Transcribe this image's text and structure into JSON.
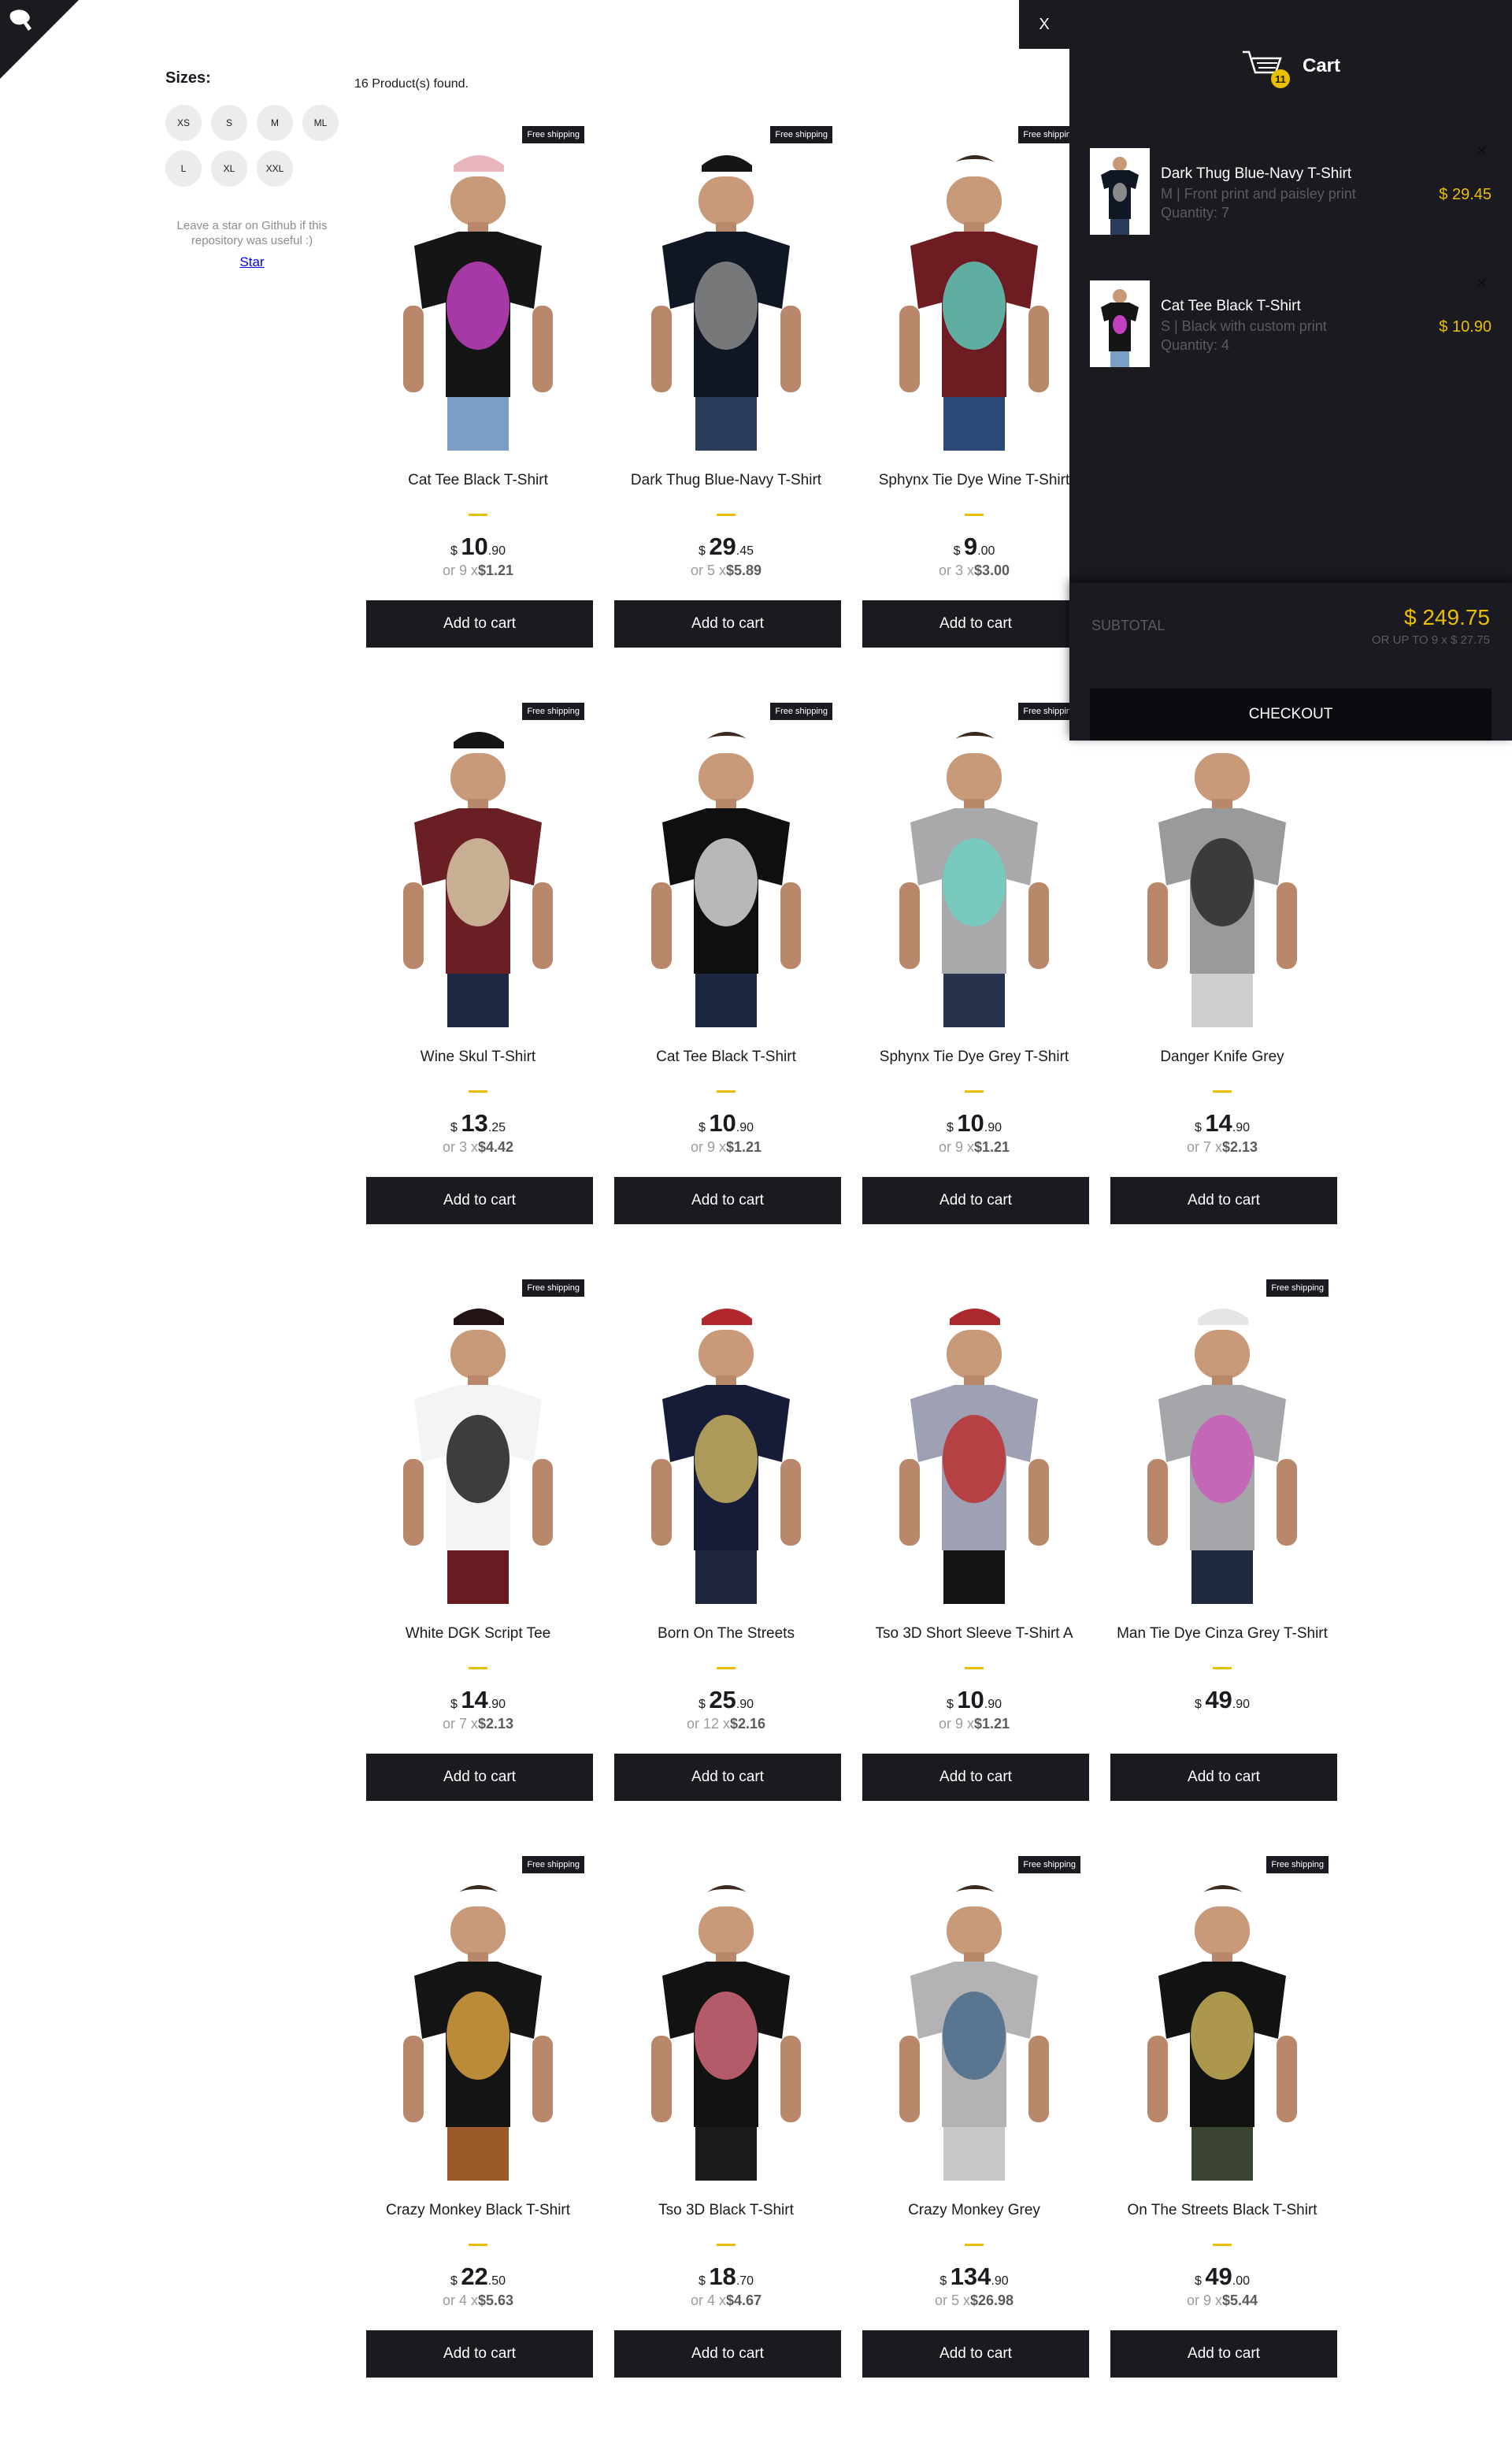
{
  "sidebar": {
    "sizes_title": "Sizes:",
    "sizes": [
      "XS",
      "S",
      "M",
      "ML",
      "L",
      "XL",
      "XXL"
    ],
    "star_note": "Leave a star on Github if this repository was useful :)",
    "star_link": "Star"
  },
  "products_found": "16 Product(s) found.",
  "add_to_cart_label": "Add to cart",
  "free_shipping_label": "Free shipping",
  "products": [
    {
      "title": "Cat Tee Black T-Shirt",
      "currency": "$",
      "int": "10",
      "dec": ".90",
      "inst_prefix": "or 9 x",
      "inst_value": "$1.21",
      "free": true,
      "shirt": "#151515",
      "print": "#c040c0",
      "cap": "#e8b4bd",
      "pants": "#7b9ec4"
    },
    {
      "title": "Dark Thug Blue-Navy T-Shirt",
      "currency": "$",
      "int": "29",
      "dec": ".45",
      "inst_prefix": "or 5 x",
      "inst_value": "$5.89",
      "free": true,
      "shirt": "#111624",
      "print": "#8a8a8a",
      "cap": "#151515",
      "pants": "#2b3c5a"
    },
    {
      "title": "Sphynx Tie Dye Wine T-Shirt",
      "currency": "$",
      "int": "9",
      "dec": ".00",
      "inst_prefix": "or 3 x",
      "inst_value": "$3.00",
      "free": true,
      "shirt": "#6e1c22",
      "print": "#5ec8b8",
      "cap": null,
      "pants": "#2c4a78"
    },
    {
      "title": "Wine Skul T-Shirt",
      "currency": "$",
      "int": "13",
      "dec": ".25",
      "inst_prefix": "or 3 x",
      "inst_value": "$4.42",
      "free": true,
      "shirt": "#6a1f24",
      "print": "#d8c9a8",
      "cap": "#151515",
      "pants": "#1e2a44"
    },
    {
      "title": "Cat Tee Black T-Shirt",
      "currency": "$",
      "int": "10",
      "dec": ".90",
      "inst_prefix": "or 9 x",
      "inst_value": "$1.21",
      "free": true,
      "shirt": "#0f0f0f",
      "print": "#d6d6d6",
      "cap": null,
      "pants": "#1c2740"
    },
    {
      "title": "Sphynx Tie Dye Grey T-Shirt",
      "currency": "$",
      "int": "10",
      "dec": ".90",
      "inst_prefix": "or 9 x",
      "inst_value": "$1.21",
      "free": true,
      "shirt": "#a9a9ab",
      "print": "#6ed0c0",
      "cap": null,
      "pants": "#27324c"
    },
    {
      "title": "Danger Knife Grey",
      "currency": "$",
      "int": "14",
      "dec": ".90",
      "inst_prefix": "or 7 x",
      "inst_value": "$2.13",
      "free": false,
      "shirt": "#9a9a9c",
      "print": "#2a2a2a",
      "cap": null,
      "pants": "#cfcfcf"
    },
    {
      "title": "White DGK Script Tee",
      "currency": "$",
      "int": "14",
      "dec": ".90",
      "inst_prefix": "or 7 x",
      "inst_value": "$2.13",
      "free": true,
      "shirt": "#f4f4f4",
      "print": "#1c1c1c",
      "cap": "#241414",
      "pants": "#6a1a22"
    },
    {
      "title": "Born On The Streets",
      "currency": "$",
      "int": "25",
      "dec": ".90",
      "inst_prefix": "or 12 x",
      "inst_value": "$2.16",
      "free": false,
      "shirt": "#161c38",
      "print": "#c8b060",
      "cap": "#b0282c",
      "pants": "#20263c"
    },
    {
      "title": "Tso 3D Short Sleeve T-Shirt A",
      "currency": "$",
      "int": "10",
      "dec": ".90",
      "inst_prefix": "or 9 x",
      "inst_value": "$1.21",
      "free": false,
      "shirt": "#9ea0b4",
      "print": "#b83030",
      "cap": "#a82a2c",
      "pants": "#141414"
    },
    {
      "title": "Man Tie Dye Cinza Grey T-Shirt",
      "currency": "$",
      "int": "49",
      "dec": ".90",
      "inst_prefix": "",
      "inst_value": "",
      "free": true,
      "shirt": "#a5a6aa",
      "print": "#c85cb8",
      "cap": "#e4e4e4",
      "pants": "#20283c"
    },
    {
      "title": "Crazy Monkey Black T-Shirt",
      "currency": "$",
      "int": "22",
      "dec": ".50",
      "inst_prefix": "or 4 x",
      "inst_value": "$5.63",
      "free": true,
      "shirt": "#141414",
      "print": "#d8a040",
      "cap": null,
      "pants": "#9a5a2a"
    },
    {
      "title": "Tso 3D Black T-Shirt",
      "currency": "$",
      "int": "18",
      "dec": ".70",
      "inst_prefix": "or 4 x",
      "inst_value": "$4.67",
      "free": false,
      "shirt": "#121212",
      "print": "#d06878",
      "cap": null,
      "pants": "#1a1a1a"
    },
    {
      "title": "Crazy Monkey Grey",
      "currency": "$",
      "int": "134",
      "dec": ".90",
      "inst_prefix": "or 5 x",
      "inst_value": "$26.98",
      "free": true,
      "shirt": "#b3b3b5",
      "print": "#4a6a8a",
      "cap": null,
      "pants": "#c7c7c7"
    },
    {
      "title": "On The Streets Black T-Shirt",
      "currency": "$",
      "int": "49",
      "dec": ".00",
      "inst_prefix": "or 9 x",
      "inst_value": "$5.44",
      "free": true,
      "shirt": "#121212",
      "print": "#c8b058",
      "cap": null,
      "pants": "#3a4430"
    }
  ],
  "cart": {
    "close_label": "X",
    "title": "Cart",
    "quantity": "11",
    "items": [
      {
        "title": "Dark Thug Blue-Navy T-Shirt",
        "desc": "M | Front print and paisley print",
        "qty": "Quantity: 7",
        "price": "$ 29.45",
        "remove": "×",
        "shirt": "#111624",
        "print": "#8a8a8a"
      },
      {
        "title": "Cat Tee Black T-Shirt",
        "desc": "S | Black with custom print",
        "qty": "Quantity: 4",
        "price": "$ 10.90",
        "remove": "×",
        "shirt": "#151515",
        "print": "#c040c0"
      }
    ],
    "subtotal_label": "SUBTOTAL",
    "subtotal_value": "$ 249.75",
    "subtotal_installments": "OR UP TO 9 x $ 27.75",
    "checkout_label": "CHECKOUT"
  },
  "colors": {
    "accent": "#eabf00",
    "dark": "#1b1a20",
    "cart_bg": "#1b1a20"
  }
}
